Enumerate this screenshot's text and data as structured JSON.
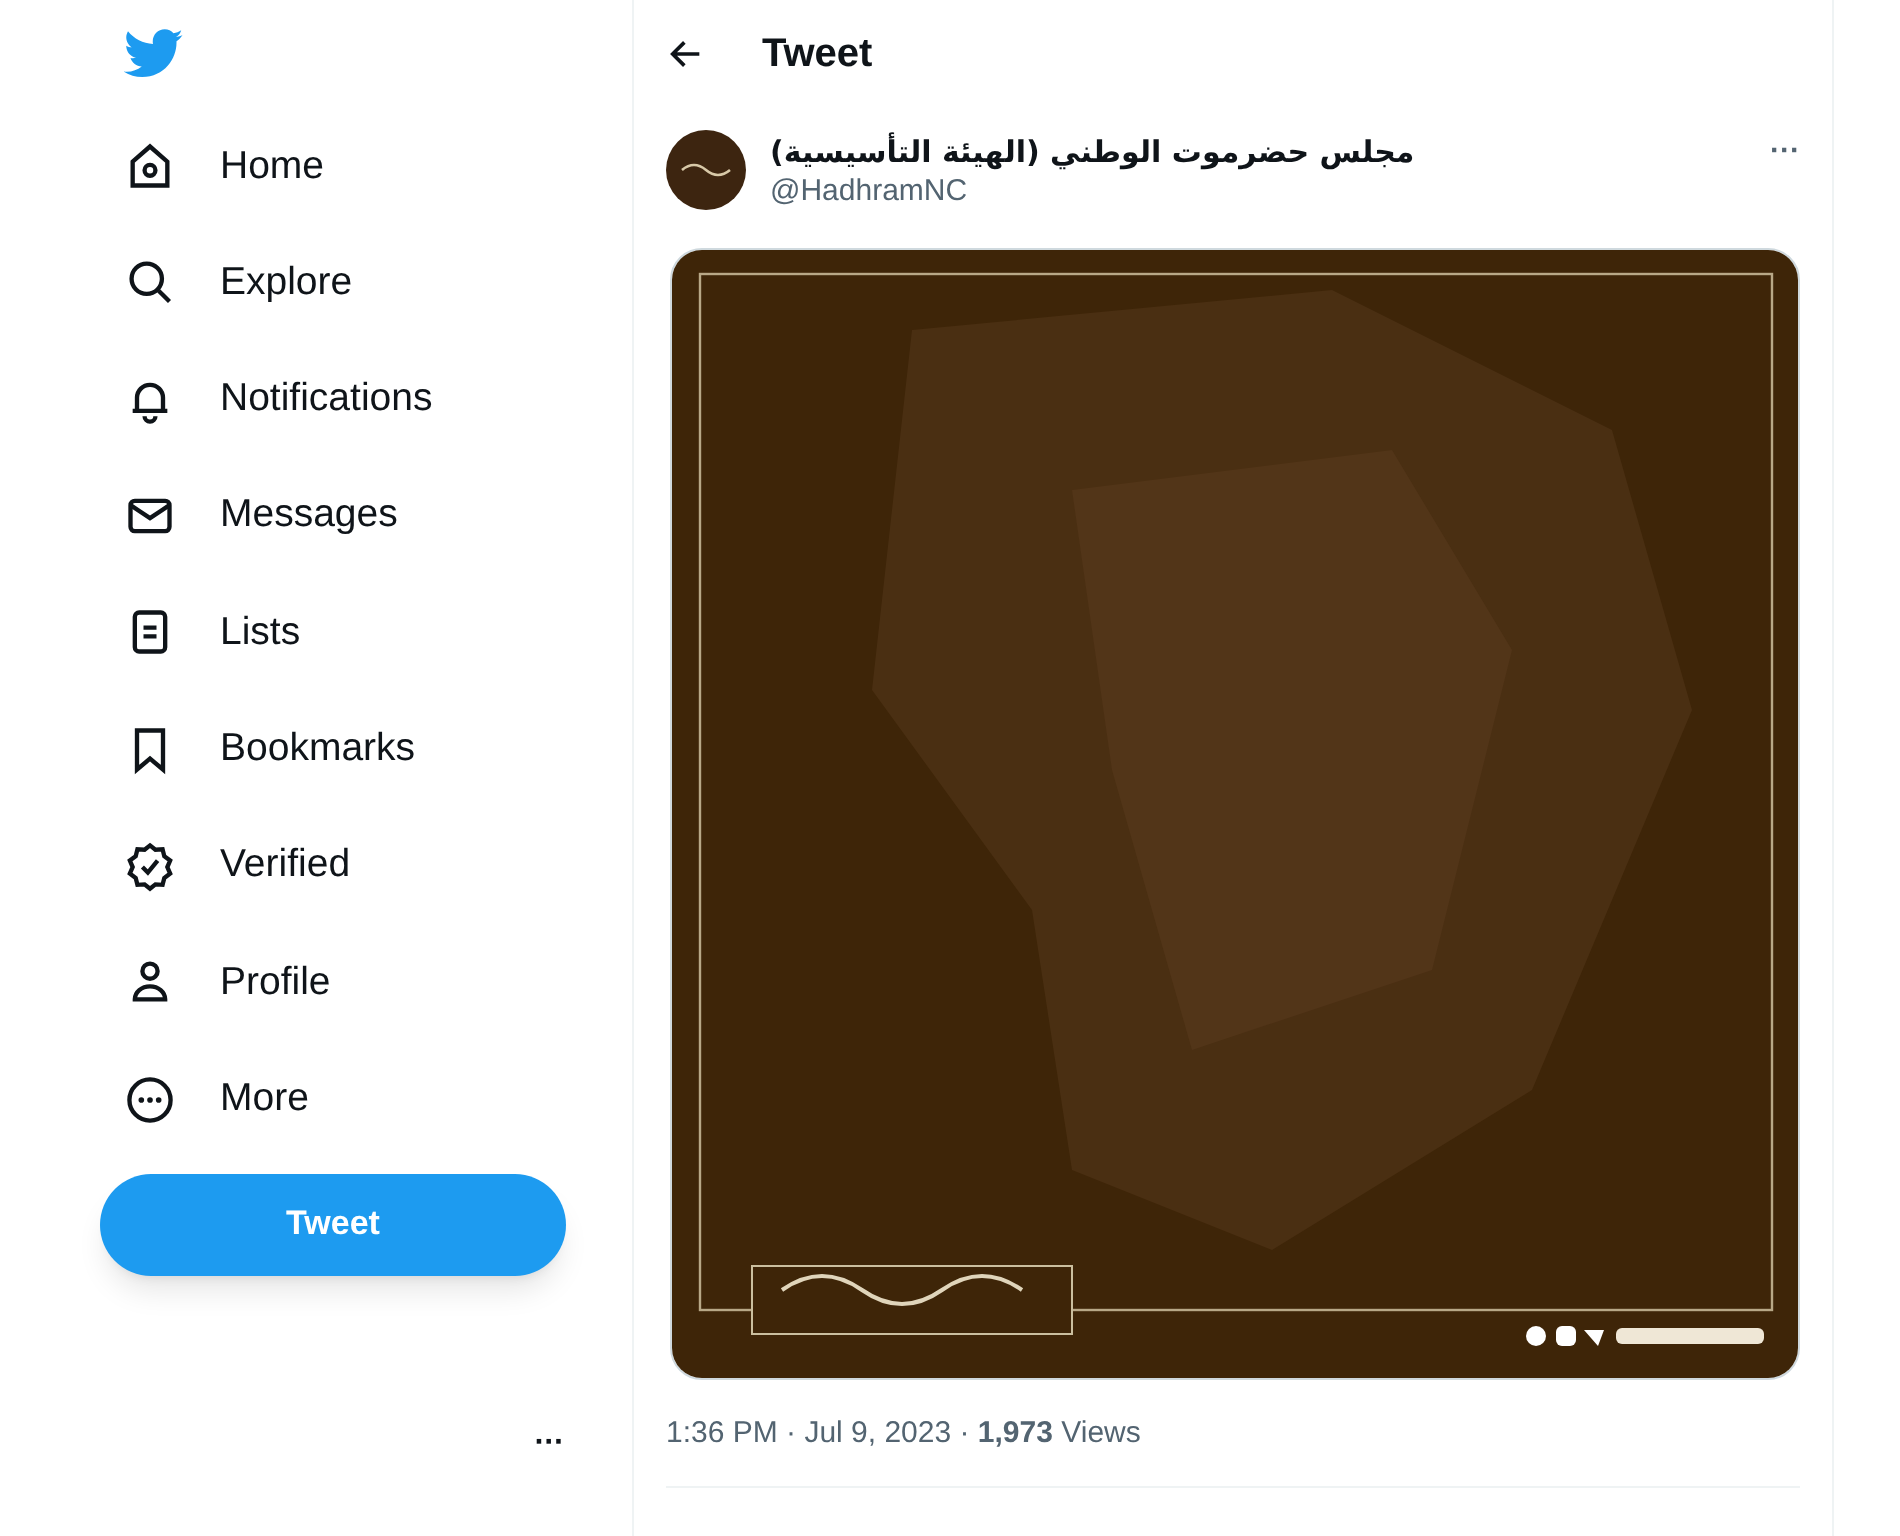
{
  "sidebar": {
    "items": [
      {
        "kind": "home",
        "label": "Home"
      },
      {
        "kind": "search",
        "label": "Explore"
      },
      {
        "kind": "bell",
        "label": "Notifications"
      },
      {
        "kind": "mail",
        "label": "Messages"
      },
      {
        "kind": "list",
        "label": "Lists"
      },
      {
        "kind": "bookmark",
        "label": "Bookmarks"
      },
      {
        "kind": "verified",
        "label": "Verified"
      },
      {
        "kind": "person",
        "label": "Profile"
      },
      {
        "kind": "more",
        "label": "More"
      }
    ],
    "tweet_button": "Tweet",
    "account_menu": "···"
  },
  "header": {
    "title": "Tweet"
  },
  "tweet": {
    "author": "مجلس حضرموت الوطني (الهيئة التأسيسية)",
    "handle": "@HadhramNC",
    "menu": "···",
    "time": "1:36 PM · Jul 9, 2023 · ",
    "views": "**1,973** Views"
  }
}
